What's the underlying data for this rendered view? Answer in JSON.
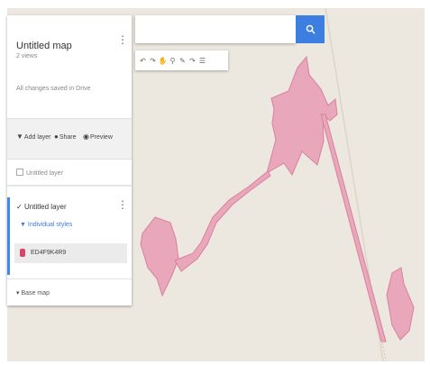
{
  "map": {
    "title": "Untitled map",
    "views": "2 views",
    "saved_status": "All changes saved in Drive"
  },
  "actions": {
    "add_layer": "Add layer",
    "share": "Share",
    "preview": "Preview"
  },
  "layers": {
    "untitled_unchecked": "Untitled layer",
    "untitled_checked": "Untitled layer",
    "styles_link": "Individual styles",
    "feature_label": "ED4F9K4R9",
    "base_map": "Base map"
  },
  "search": {
    "placeholder": ""
  },
  "icons": {
    "search": "search-icon",
    "more": "more-vert-icon",
    "toolbar": [
      "undo-icon",
      "redo-icon",
      "hand-icon",
      "marker-icon",
      "draw-line-icon",
      "route-icon",
      "ruler-icon"
    ]
  },
  "colors": {
    "accent": "#3d7fe0",
    "shape_fill": "#e9a7bc",
    "shape_stroke": "#d9809e",
    "feature_pin": "#d8436b",
    "map_background": "#ece8e0"
  }
}
